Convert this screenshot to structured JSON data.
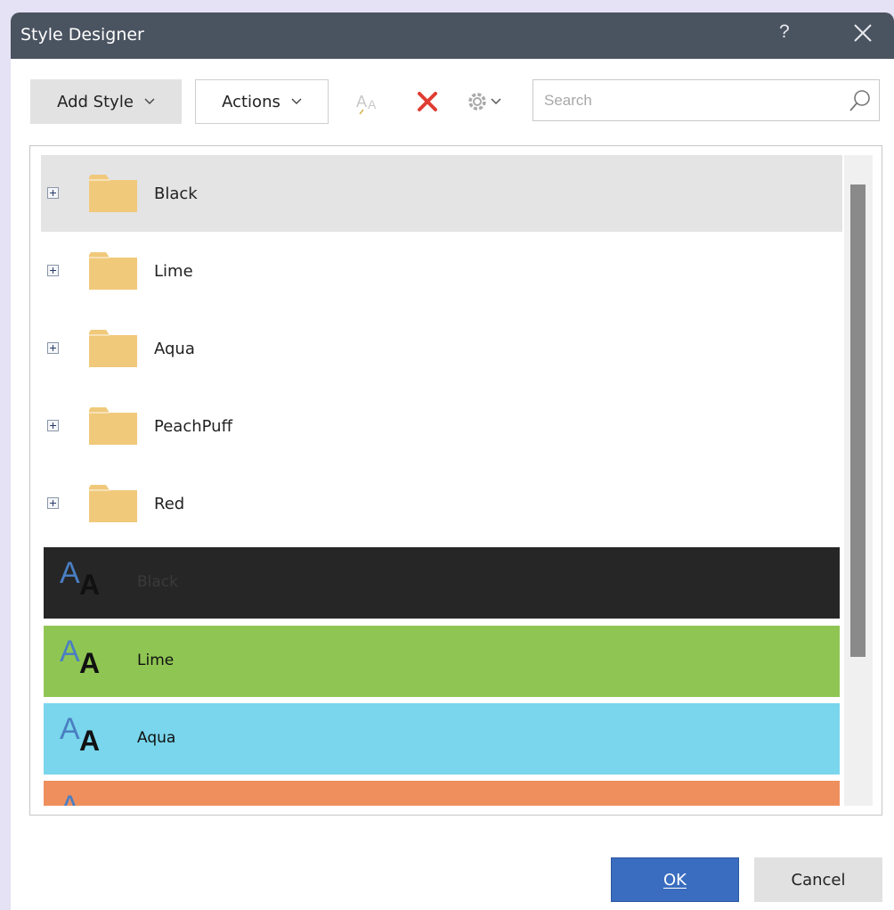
{
  "window": {
    "title": "Style Designer",
    "help_label": "?"
  },
  "toolbar": {
    "add_style_label": "Add Style",
    "actions_label": "Actions",
    "icons": [
      "font-size-icon",
      "delete-icon",
      "gear-icon"
    ],
    "delete_color": "#e03c31"
  },
  "search": {
    "placeholder": "Search",
    "value": ""
  },
  "folders": [
    {
      "label": "Black",
      "selected": true
    },
    {
      "label": "Lime",
      "selected": false
    },
    {
      "label": "Aqua",
      "selected": false
    },
    {
      "label": "PeachPuff",
      "selected": false
    },
    {
      "label": "Red",
      "selected": false
    }
  ],
  "styles": [
    {
      "label": "Black",
      "background": "#262626",
      "text_color": "#3a3a3a"
    },
    {
      "label": "Lime",
      "background": "#8fc653",
      "text_color": "#111111"
    },
    {
      "label": "Aqua",
      "background": "#79d6ec",
      "text_color": "#111111"
    },
    {
      "label": "",
      "background": "#ef8f5d",
      "text_color": "#111111"
    }
  ],
  "colors": {
    "folder": "#f0c97b",
    "titlebar": "#4a5360",
    "ok_button": "#3a6dbf"
  },
  "buttons": {
    "ok_label": "OK",
    "cancel_label": "Cancel"
  }
}
